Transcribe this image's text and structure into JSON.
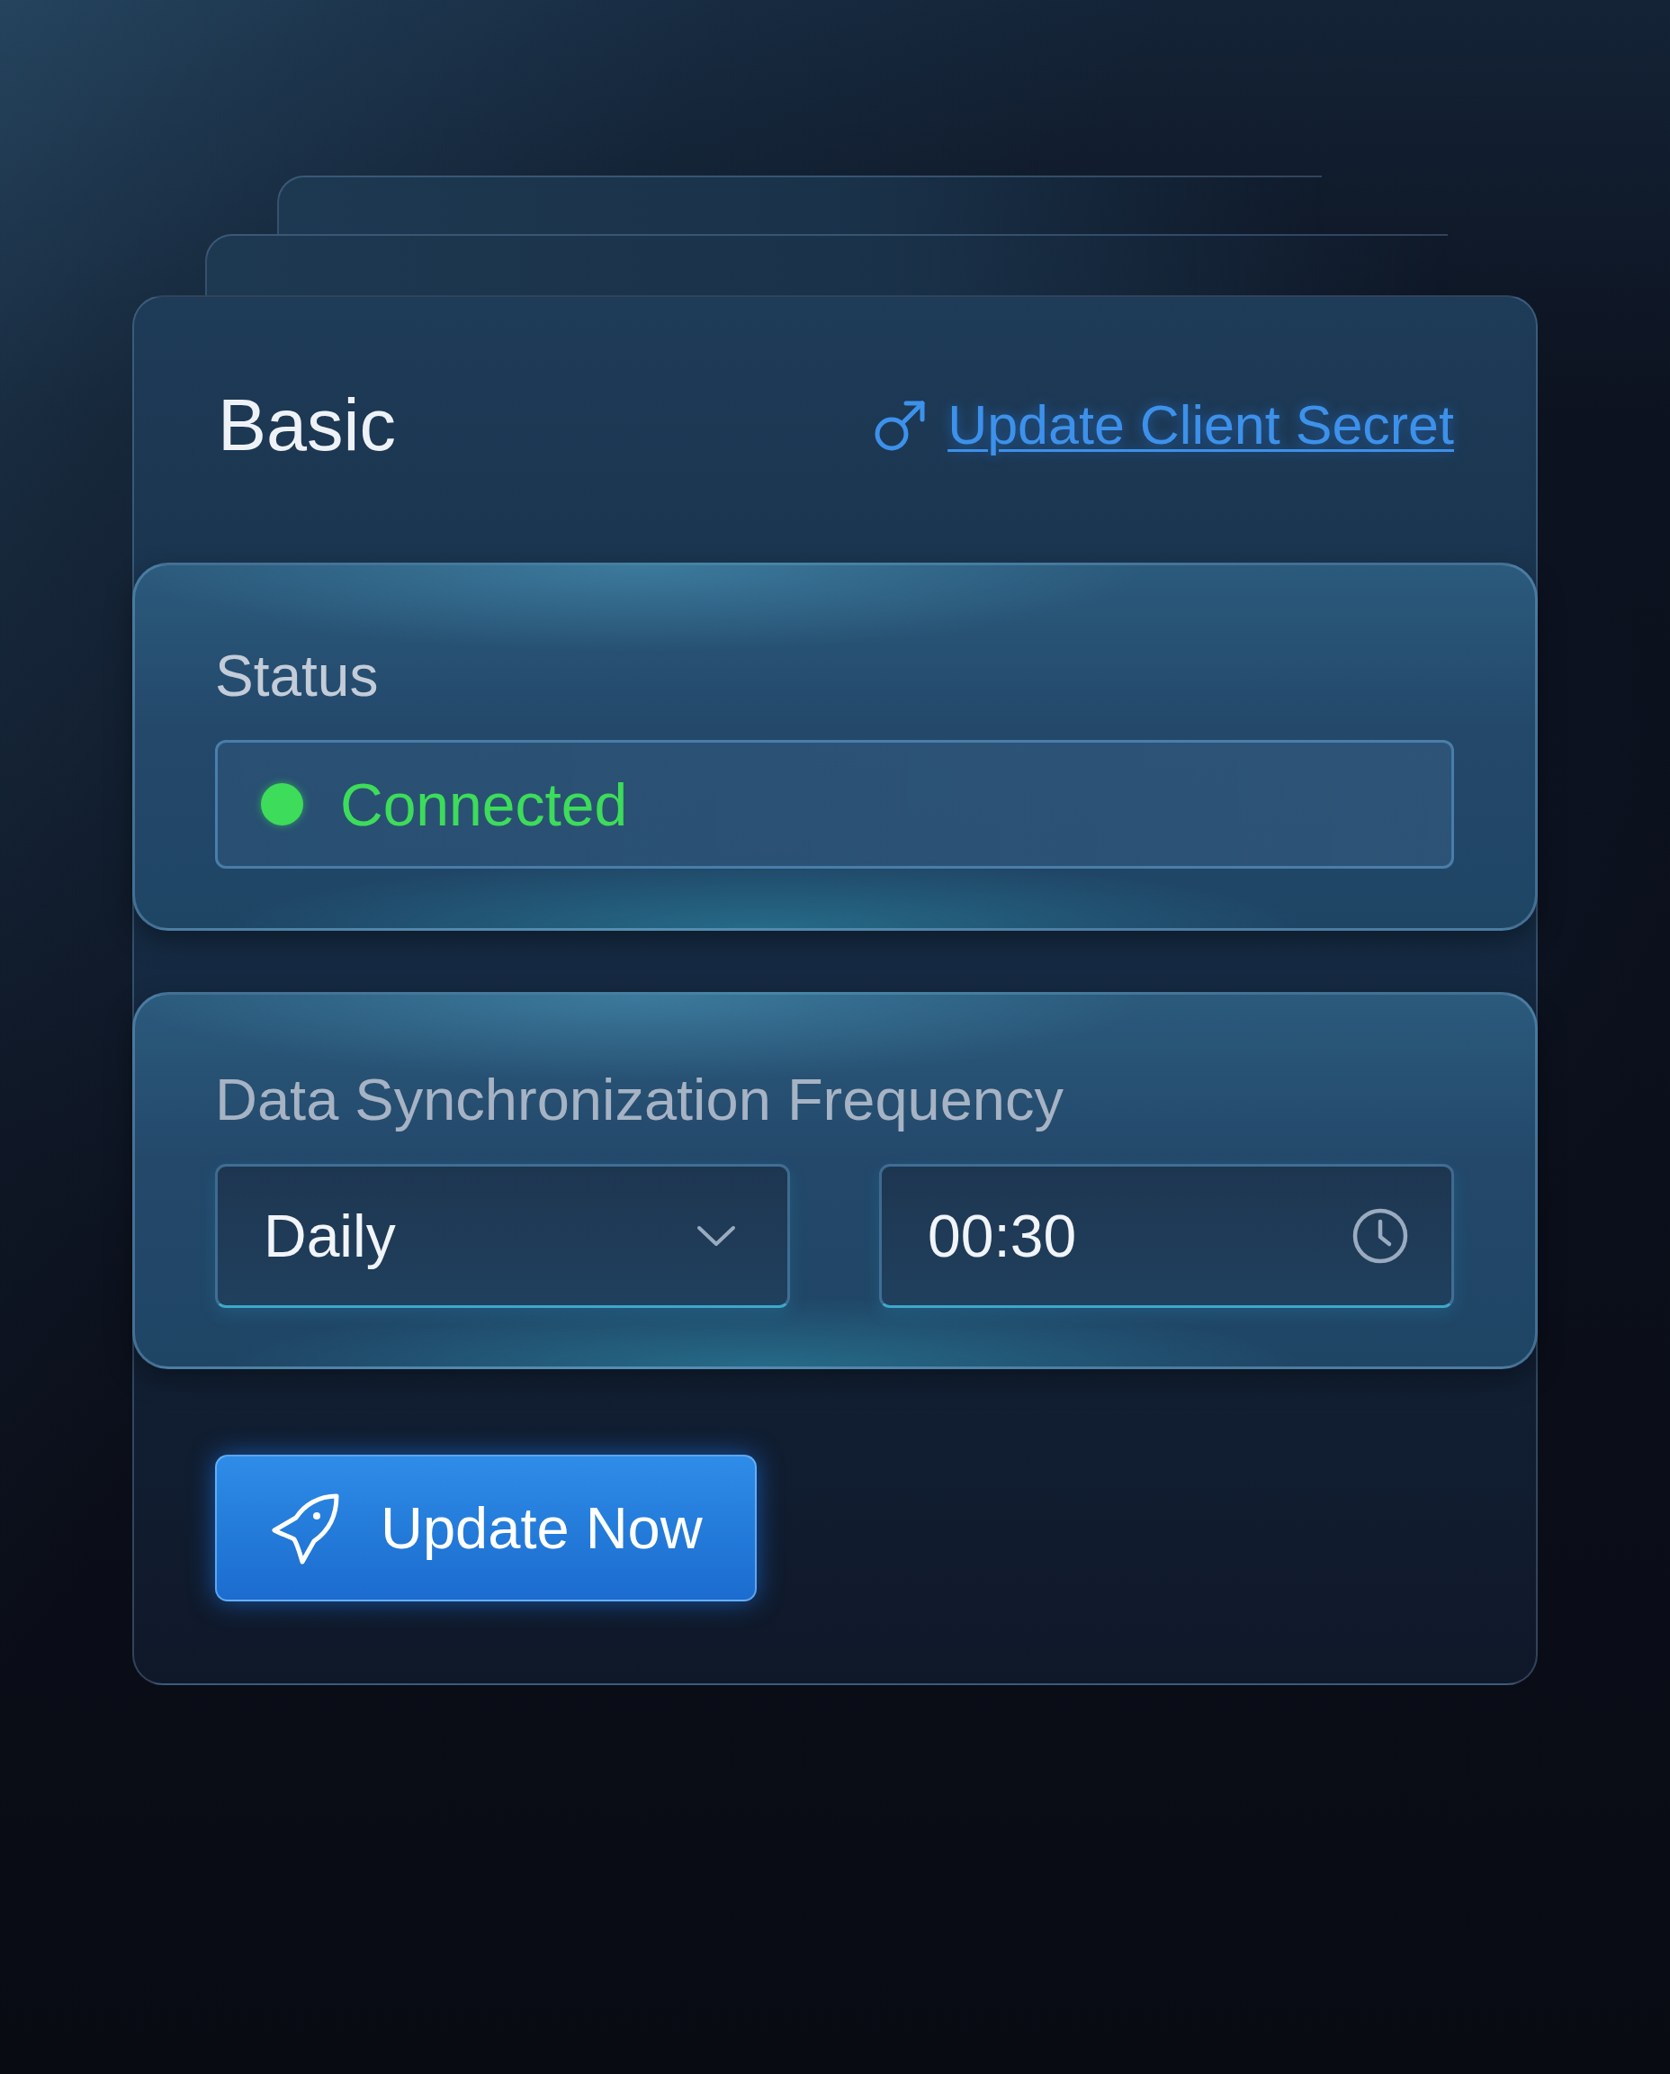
{
  "header": {
    "title": "Basic",
    "link": "Update Client Secret"
  },
  "status": {
    "label": "Status",
    "value": "Connected",
    "connected": true
  },
  "sync": {
    "label": "Data Synchronization Frequency",
    "frequency": {
      "value": "Daily"
    },
    "time": {
      "value": "00:30"
    }
  },
  "button": {
    "label": "Update Now"
  }
}
